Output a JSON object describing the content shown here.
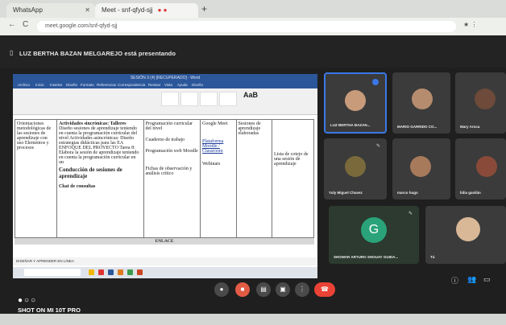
{
  "browser": {
    "tab1_title": "WhatsApp",
    "tab2_title": "Meet - snf-qfyd-sjj",
    "tab2_indicator": "● ●",
    "url": "meet.google.com/snf-qfyd-sjj"
  },
  "meet": {
    "presenting_text": "LUZ BERTHA BAZAN MELGAREJO está presentando"
  },
  "word": {
    "title": "SESIÓN 3 (4) [RECUPERADO] - Word",
    "tabs": [
      "Archivo",
      "Inicio",
      "Insertar",
      "Diseño",
      "Formato",
      "Referencias",
      "Correspondencia",
      "Revisar",
      "Vista",
      "Ayuda",
      "Diseño"
    ],
    "aa_label": "AaB",
    "status": "DISEÑAR Y APRENDER EN LÍNEA"
  },
  "table": {
    "col1": "Orientaciones metodológicas de las sesiones de aprendizaje con uso Elementos y procesos",
    "col2_title": "Actividades sincrónicas: Talleres",
    "col2_body": "Diseño sesiones de aprendizaje teniendo en cuenta la programación curricular del nivel Actividades asincrónicas: Diseño estrategias didácticas para las EA ENFOQUE DEL PROYECTO Tarea 8: Elabora la sesión de aprendizaje teniendo en cuenta la programación curricular en un",
    "col2_bold": "Conducción de sesiones de aprendizaje",
    "col2_foot": "Chat de consultas",
    "col3_a": "Programación curricular del nivel",
    "col3_b": "Cuaderno de trabajo",
    "col3_c": "Programación web Moodle",
    "col3_d": "Fichas de observación y análisis crítico",
    "col4_a": "Google Meet",
    "col4_b": "Plataforma Moodle / Classroom",
    "col4_c": "Webinars",
    "col5": "Sesiones de aprendizaje elaboradas",
    "col6": "Lista de cotejo de una sesión de aprendizaje",
    "enlace": "ENLACE"
  },
  "participants": [
    {
      "name": "LUZ BERTHA BAZAN..."
    },
    {
      "name": "MARIO GARRIDO CO..."
    },
    {
      "name": "Mary Aroca"
    },
    {
      "name": "Yuly Miguel Chavez"
    },
    {
      "name": "marco hugo"
    },
    {
      "name": "lidia gavilán"
    },
    {
      "name": "SHOWAR ARTURO SHOUAY GUIDA...",
      "initial": "G"
    },
    {
      "name": "Tú"
    }
  ],
  "watermark": "SHOT ON MI 10T PRO",
  "colors": {
    "accent": "#3b78e7",
    "end_call": "#ea4335",
    "avatar_g": "#2aa37a"
  }
}
